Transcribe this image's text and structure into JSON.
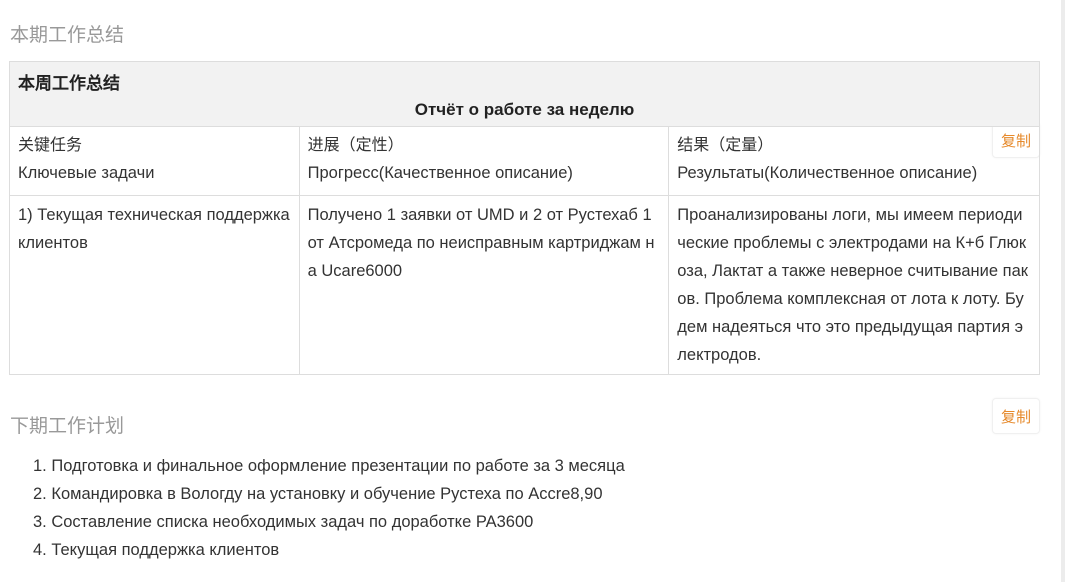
{
  "summary": {
    "title": "本期工作总结",
    "copy_label": "复制",
    "table": {
      "title_cn": "本周工作总结",
      "title_ru": "Отчёт о работе за неделю",
      "columns": [
        {
          "cn": "关键任务",
          "ru": "Ключевые задачи"
        },
        {
          "cn": "进展（定性）",
          "ru": "Прогресс(Качественное описание)"
        },
        {
          "cn": "结果（定量）",
          "ru": "Результаты(Количественное описание)"
        }
      ],
      "row": {
        "task": "1) Текущая техническая поддержка клиентов",
        "progress": "Получено 1  заявки от UMD  и 2 от Рустехаб 1 от Атсромеда по неисправным картриджам на Ucare6000",
        "result": "Проанализированы логи, мы имеем периодические проблемы с электродами на К+б Глюкоза, Лактат а также неверное считывание паков. Проблема комплексная от лота к лоту. Будем надеяться что это предыдущая партия электродов."
      }
    }
  },
  "plan": {
    "title": "下期工作计划",
    "copy_label": "复制",
    "items": [
      "1. Подготовка и финальное оформление презентации по работе за 3 месяца",
      "2. Командировка в Вологду на установку и обучение Рустеха по Accre8,90",
      "3. Составление списка необходимых задач по доработке PA3600",
      "4. Текущая поддержка клиентов"
    ]
  }
}
